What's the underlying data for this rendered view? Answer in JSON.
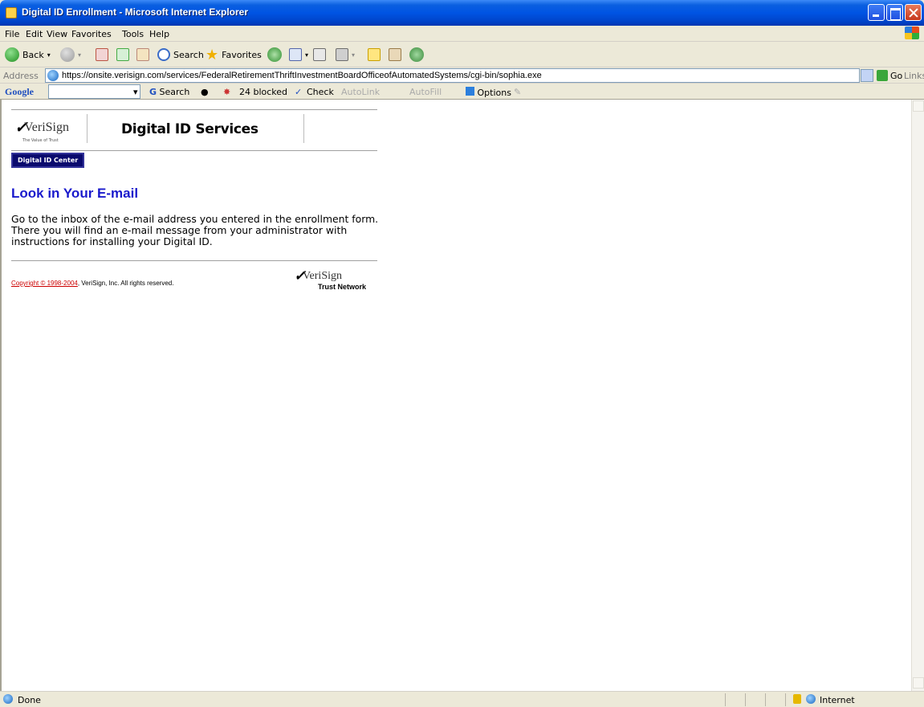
{
  "window": {
    "title": "Digital ID Enrollment - Microsoft Internet Explorer"
  },
  "menu": [
    "File",
    "Edit",
    "View",
    "Favorites",
    "Tools",
    "Help"
  ],
  "toolbar": {
    "back": "Back",
    "search": "Search",
    "favorites": "Favorites"
  },
  "address": {
    "label": "Address",
    "url": "https://onsite.verisign.com/services/FederalRetirementThriftInvestmentBoardOfficeofAutomatedSystems/cgi-bin/sophia.exe",
    "go": "Go",
    "links": "Links"
  },
  "google": {
    "logo": "Google",
    "search": "Search",
    "blocked": "24 blocked",
    "check": "Check",
    "autolink": "AutoLink",
    "autofill": "AutoFill",
    "options": "Options"
  },
  "page": {
    "brand": "VeriSign",
    "tagline": "The Value of Trust",
    "services_title": "Digital ID Services",
    "tab": "Digital ID Center",
    "heading": "Look in Your E-mail",
    "instructions": "Go to the inbox of the e-mail address you entered in the enrollment form. There you will find an e-mail message from your administrator with instructions for installing your Digital ID.",
    "copyright_link": "Copyright © 1998-2004",
    "copyright_rest": ", VeriSign, Inc. All rights reserved.",
    "footer_brand": "VeriSign",
    "footer_network": "Trust Network"
  },
  "status": {
    "text": "Done",
    "zone": "Internet"
  },
  "colors": {
    "heading": "#1a1acc",
    "tab_bg": "#0a0a6e",
    "link": "#cc0000",
    "brand_check": "#000000"
  }
}
